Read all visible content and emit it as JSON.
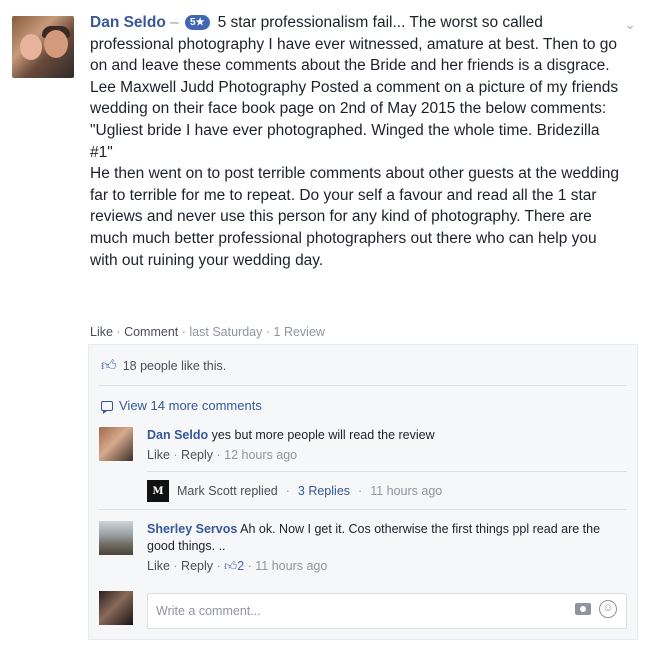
{
  "review": {
    "author": "Dan Seldo",
    "dash": "–",
    "rating_badge": "5★",
    "chevron": "⌄",
    "text_first_line": "5 star professionalism fail... The worst so called professional photography I have ever witnessed, amature at best. Then to go on and leave these comments about the Bride and her friends is a disgrace.",
    "text_second": "Lee Maxwell Judd Photography Posted a comment on a picture of my friends wedding on their face book page on 2nd of May 2015 the below comments: \"Ugliest bride I have ever photographed. Winged the whole time. Bridezilla #1\"",
    "text_third": "He then went on to post terrible comments about other guests at the wedding far to terrible for me to repeat. Do your self a favour and read all the 1 star reviews and never use this person for any kind of photography. There are much much better professional photographers out there who can help you with out ruining your wedding day.",
    "actions": {
      "like": "Like",
      "comment": "Comment",
      "time": "last Saturday",
      "reviews": "1 Review",
      "sep": "·"
    }
  },
  "panel": {
    "likes_text": "18 people like this.",
    "view_more": "View 14 more comments",
    "comments": [
      {
        "author": "Dan Seldo",
        "text": "yes but more people will read the review",
        "like": "Like",
        "reply": "Reply",
        "time": "12 hours ago"
      },
      {
        "author": "Sherley Servos",
        "text": "Ah ok. Now I get it. Cos otherwise the first things ppl read are the good things. ..",
        "like": "Like",
        "reply": "Reply",
        "like_count": "2",
        "time": "11 hours ago"
      }
    ],
    "reply_summary": {
      "name": "Mark Scott replied",
      "replies": "3 Replies",
      "time": "11 hours ago",
      "avatar_text": "M"
    },
    "write_placeholder": "Write a comment..."
  },
  "colors": {
    "link": "#365899",
    "meta": "#90949c",
    "badge": "#4267b2",
    "panel_bg": "#f6f7f9"
  }
}
